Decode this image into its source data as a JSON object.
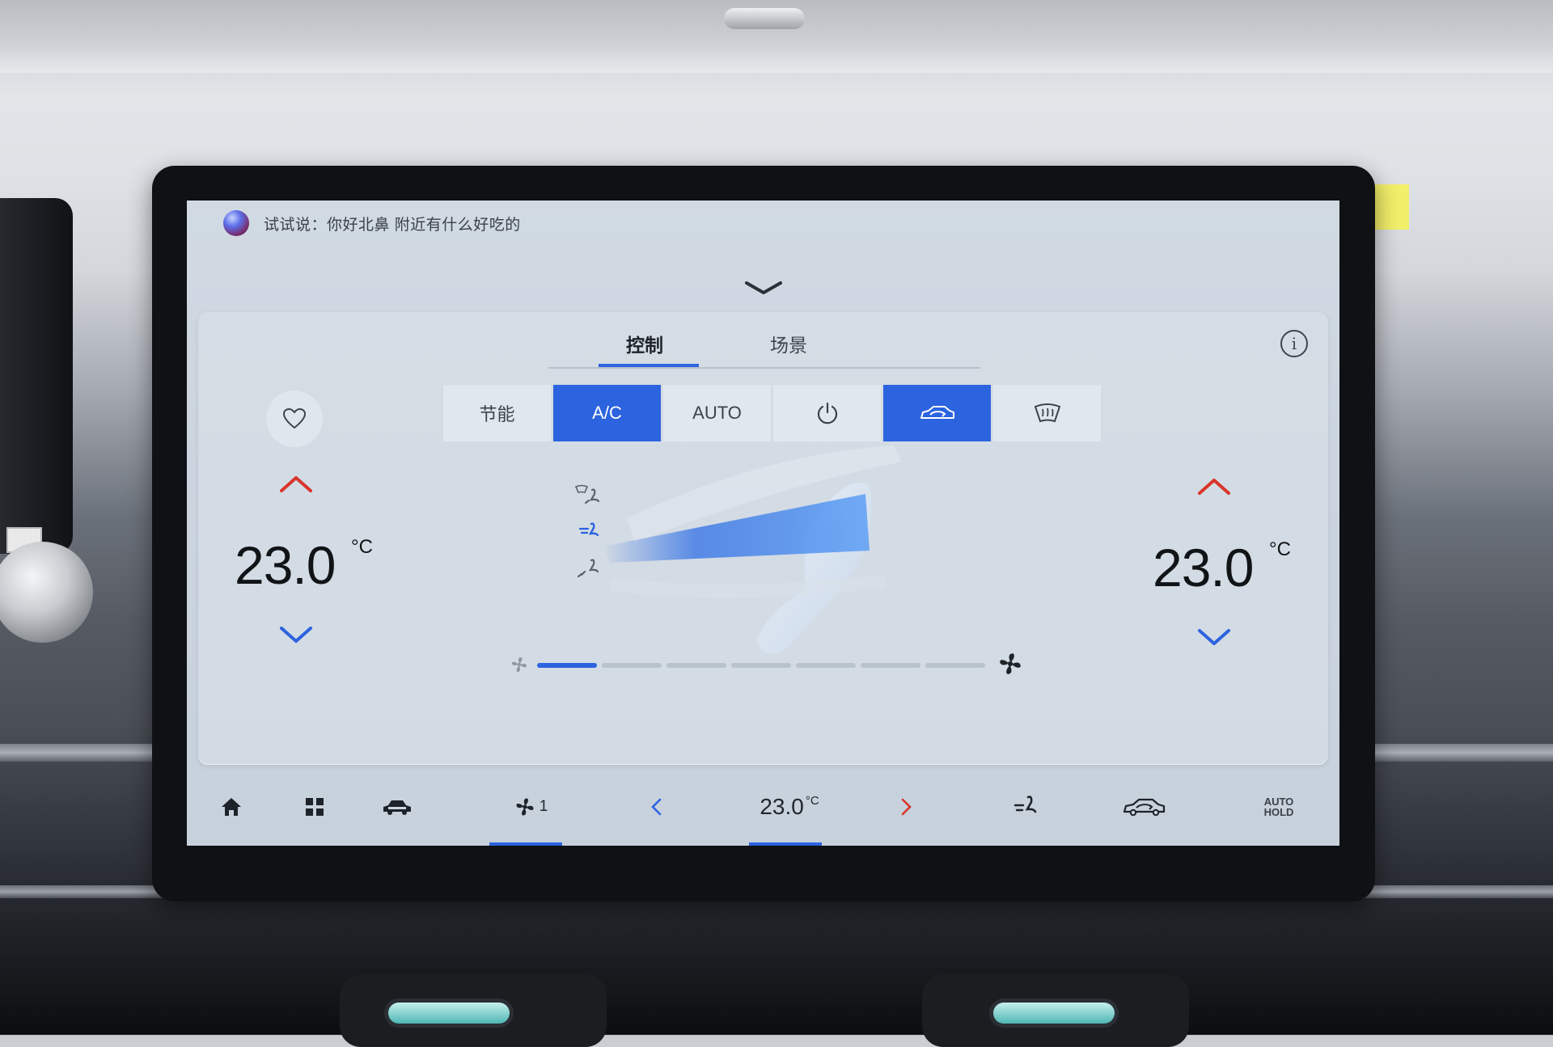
{
  "voice_assistant": {
    "hint": "试试说：你好北鼻 附近有什么好吃的"
  },
  "tabs": [
    {
      "label": "控制",
      "active": true
    },
    {
      "label": "场景",
      "active": false
    }
  ],
  "modes": [
    {
      "label": "节能",
      "active": false
    },
    {
      "label": "A/C",
      "active": true
    },
    {
      "label": "AUTO",
      "active": false
    },
    {
      "icon": "power-icon",
      "active": false
    },
    {
      "icon": "recirculation-icon",
      "active": true
    },
    {
      "icon": "front-defrost-icon",
      "active": false
    }
  ],
  "driver": {
    "temperature": "23.0",
    "unit": "°C"
  },
  "passenger": {
    "temperature": "23.0",
    "unit": "°C"
  },
  "airflow": {
    "modes": [
      "windshield-feet",
      "face",
      "feet"
    ],
    "selected": "face"
  },
  "fan": {
    "level": 1,
    "levels": 7
  },
  "bottom_bar": {
    "fan_level": "1",
    "temperature": "23.0",
    "temp_unit": "°C",
    "auto_hold": "AUTO\nHOLD"
  },
  "colors": {
    "accent": "#2c63df",
    "increase_arrow": "#d9352b",
    "decrease_arrow": "#2c63df",
    "screen_bg": "#ccd5df"
  }
}
